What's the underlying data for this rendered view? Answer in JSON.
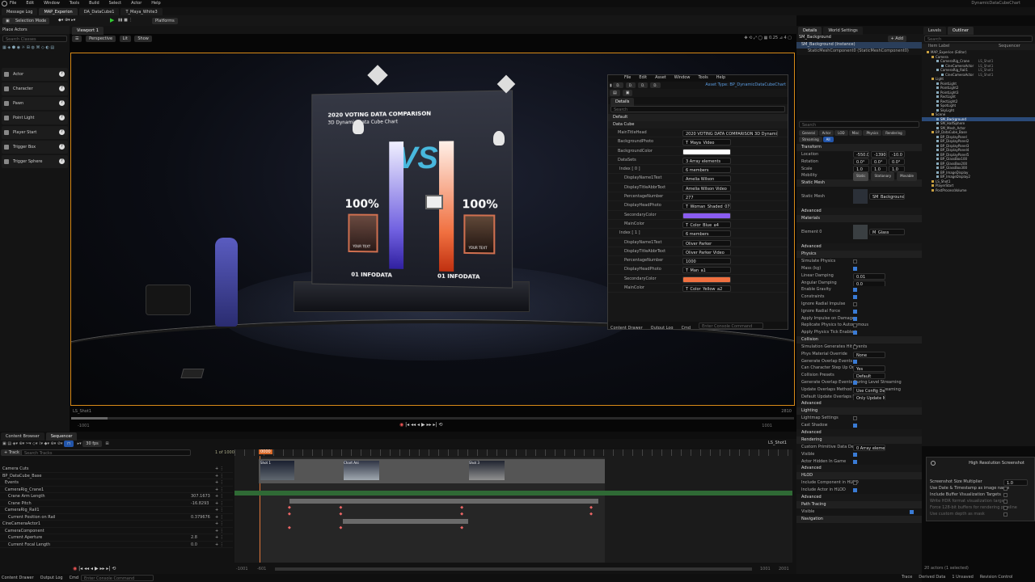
{
  "menubar": {
    "items": [
      "File",
      "Edit",
      "Window",
      "Tools",
      "Build",
      "Select",
      "Actor",
      "Help"
    ],
    "project": "DynamicDataCubeChart"
  },
  "tabs": [
    "Message Log",
    "MAP_Experion",
    "DA_DataCube1",
    "T_Maya_White3"
  ],
  "toolbar": {
    "mode": "Selection Mode",
    "platforms": "Platforms"
  },
  "place_actors": {
    "title": "Place Actors",
    "search": "Search Classes",
    "items": [
      "Actor",
      "Character",
      "Pawn",
      "Point Light",
      "Player Start",
      "Trigger Box",
      "Trigger Sphere"
    ]
  },
  "viewport": {
    "tab": "Viewport 1",
    "perspective": "Perspective",
    "lit": "Lit",
    "show": "Show",
    "camera": "LS_Shot1",
    "timecode_left": "-1001",
    "timecode_right": "2810",
    "num_right": "0.25",
    "num_right2": "4",
    "frames_left": "-1001",
    "frames_right": "1001"
  },
  "scene": {
    "title1": "2020 VOTING DATA COMPARISON",
    "title2": "3D Dynamic Data Cube Chart",
    "vs": "VS",
    "left_pct": "100%",
    "right_pct": "100%",
    "left_label": "01 INFODATA",
    "right_label": "01 INFODATA",
    "your_text": "YOUR TEXT"
  },
  "floating": {
    "menu": [
      "File",
      "Edit",
      "Asset",
      "Window",
      "Tools",
      "Help"
    ],
    "tab": "Details",
    "search": "Search",
    "asset_type": "Asset Type: BP_DynamicDataCubeChart",
    "default": "Default",
    "data_cube": "Data Cube",
    "rows": [
      {
        "label": "MainTitleHead",
        "value": "2020 VOTING DATA COMPARISON 3D Dynamic Data Cube Chart"
      },
      {
        "label": "BackgroundPhoto",
        "value": "T_Maya_Video"
      },
      {
        "label": "BackgroundColor",
        "value": ""
      },
      {
        "label": "DataSets",
        "value": "3 Array elements"
      },
      {
        "label": "Index [ 0 ]",
        "value": "6 members"
      },
      {
        "label": "DisplayName1Text",
        "value": "Amelia Wilson"
      },
      {
        "label": "DisplayTitleAbbrText",
        "value": "Amelia Wilson Video"
      },
      {
        "label": "PercentageNumber",
        "value": "277"
      },
      {
        "label": "DisplayHeadPhoto",
        "value": "T_Woman_Shaded_07"
      },
      {
        "label": "SecondaryColor",
        "value": ""
      },
      {
        "label": "MainColor",
        "value": "T_Color_Blue_a4"
      },
      {
        "label": "Index [ 1 ]",
        "value": "6 members"
      },
      {
        "label": "DisplayName1Text",
        "value": "Oliver Parker"
      },
      {
        "label": "DisplayTitleAbbrText",
        "value": "Oliver Parker Video"
      },
      {
        "label": "PercentageNumber",
        "value": "1000"
      },
      {
        "label": "DisplayHeadPhoto",
        "value": "T_Man_a1"
      },
      {
        "label": "SecondaryColor",
        "value": ""
      },
      {
        "label": "MainColor",
        "value": "T_Color_Yellow_a2"
      }
    ],
    "footer": [
      "Content Drawer",
      "Output Log",
      "Cmd"
    ],
    "console": "Enter Console Command"
  },
  "details": {
    "tab": "Details",
    "tab2": "World Settings",
    "actor": "SM_Background",
    "add": "+ Add",
    "instance": "SM_Background (Instance)",
    "component": "StaticMeshComponent0 (StaticMeshComponent0)",
    "search": "Search",
    "filters": [
      "General",
      "Actor",
      "LOD",
      "Misc",
      "Physics",
      "Rendering",
      "Streaming",
      "All"
    ],
    "transform": "Transform",
    "location": "Location",
    "rotation": "Rotation",
    "scale": "Scale",
    "loc_vals": [
      "-550.0",
      "-1390.80",
      "-10.0"
    ],
    "rot_vals": [
      "0.0°",
      "0.0°",
      "0.0°"
    ],
    "scale_vals": [
      "1.0",
      "1.0",
      "1.0"
    ],
    "mobility": "Mobility",
    "mob_opts": [
      "Static",
      "Stationary",
      "Movable"
    ],
    "static_mesh_sec": "Static Mesh",
    "static_mesh": "Static Mesh",
    "mesh_val": "SM_Background",
    "materials": "Materials",
    "element0": "Element 0",
    "mat_val": "M_Glass",
    "physics": "Physics",
    "phys_rows": [
      "Simulate Physics",
      "Mass (kg)",
      "Linear Damping",
      "Angular Damping",
      "Enable Gravity",
      "Constraints",
      "Ignore Radial Impulse",
      "Ignore Radial Force",
      "Apply Impulse on Damage",
      "Replicate Physics to Autonomous",
      "Apply Physics Tick Enabled"
    ],
    "phys_vals": [
      "",
      "",
      "0.01",
      "0.0",
      "",
      "",
      "",
      "",
      "",
      "",
      ""
    ],
    "collision": "Collision",
    "coll_rows": [
      "Simulation Generates Hit Events",
      "Phys Material Override",
      "Generate Overlap Events",
      "Can Character Step Up On",
      "Collision Presets",
      "Generate Overlap Events During Level Streaming",
      "Update Overlaps Method During Level Streaming",
      "Default Update Overlaps Method"
    ],
    "coll_vals": [
      "",
      "None",
      "",
      "Yes",
      "Default",
      "",
      "Use Config Default",
      "Only Update Movable"
    ],
    "lighting": "Lighting",
    "light_rows": [
      "Lightmap Settings",
      "Cast Shadow"
    ],
    "rendering": "Rendering",
    "rend_rows": [
      "Custom Primitive Data Defaults",
      "Visible",
      "Actor Hidden In Game"
    ],
    "rend_vals": [
      "0 Array elements",
      "",
      ""
    ],
    "hlod": "HLOD",
    "hlod_rows": [
      "Include Component in HLOD",
      "Include Actor in HLOD"
    ],
    "path_tracing": "Path Tracing",
    "visible": "Visible",
    "navigation": "Navigation",
    "advanced": "Advanced"
  },
  "outliner": {
    "tab": "Levels",
    "tab2": "Outliner",
    "search": "Search",
    "col1": "Item Label",
    "col2": "Sequencer",
    "items": [
      {
        "t": "MAP_Experion (Editor)",
        "d": 0
      },
      {
        "t": "Camera",
        "d": 1
      },
      {
        "t": "CameraRig_Crane",
        "d": 2,
        "x": "LS_Shot1"
      },
      {
        "t": "CineCameraActor",
        "d": 3,
        "x": "LS_Shot1"
      },
      {
        "t": "CameraRig_Rail1",
        "d": 2,
        "x": "LS_Shot1"
      },
      {
        "t": "CineCameraActor",
        "d": 3,
        "x": "LS_Shot1"
      },
      {
        "t": "Light",
        "d": 1
      },
      {
        "t": "PointLight",
        "d": 2
      },
      {
        "t": "PointLight2",
        "d": 2
      },
      {
        "t": "PointLight3",
        "d": 2
      },
      {
        "t": "RectLight",
        "d": 2
      },
      {
        "t": "RectLight2",
        "d": 2
      },
      {
        "t": "SpotLight",
        "d": 2
      },
      {
        "t": "SkyLight",
        "d": 2
      },
      {
        "t": "Scene",
        "d": 1
      },
      {
        "t": "SM_Background",
        "d": 2,
        "sel": true
      },
      {
        "t": "SM_HalfSphere",
        "d": 2
      },
      {
        "t": "SM_Mesh_Actor",
        "d": 2
      },
      {
        "t": "BP_DataCube_Base",
        "d": 1
      },
      {
        "t": "BP_DisplayPanel",
        "d": 2
      },
      {
        "t": "BP_DisplayPanel2",
        "d": 2
      },
      {
        "t": "BP_DisplayPanel3",
        "d": 2
      },
      {
        "t": "BP_DisplayPanel4",
        "d": 2
      },
      {
        "t": "BP_DisplayPanel5",
        "d": 2
      },
      {
        "t": "BP_GlassBox100",
        "d": 2
      },
      {
        "t": "BP_GlassBox200",
        "d": 2
      },
      {
        "t": "BP_GlassBox300",
        "d": 2
      },
      {
        "t": "BP_ImageDisplay",
        "d": 2
      },
      {
        "t": "BP_ImageDisplay2",
        "d": 2
      },
      {
        "t": "LS_Shot1",
        "d": 1
      },
      {
        "t": "PlayerStart",
        "d": 1
      },
      {
        "t": "PostProcessVolume",
        "d": 1
      }
    ],
    "footer": "20 actors (1 selected)"
  },
  "hrs": {
    "title": "High Resolution Screenshot",
    "rows": [
      "Screenshot Size Multiplier",
      "Use Date & Timestamp as image name",
      "Include Buffer Visualization Targets",
      "Write HDR format visualization targets",
      "Force 128-bit buffers for rendering pipeline",
      "Use custom depth as mask"
    ],
    "mult": "1.0"
  },
  "sequencer": {
    "tab1": "Content Browser",
    "tab2": "Sequencer",
    "fps": "30 fps",
    "shot": "LS_Shot1",
    "search": "Search Tracks",
    "counter": "1 of 1000",
    "track_btn": "+ Track",
    "frame": "0000",
    "tracks": [
      "Camera Cuts",
      "BP_DataCube_Base",
      "Events",
      "CameraRig_Crane1",
      "Crane Arm Length",
      "Crane Pitch",
      "CameraRig_Rail1",
      "Current Position on Rail",
      "CineCameraActor1",
      "CameraComponent",
      "Current Aperture",
      "Current Focal Length"
    ],
    "track_vals": [
      "",
      "",
      "",
      "",
      "307.1673",
      "-16.8293",
      "",
      "0.379676",
      "",
      "",
      "2.8",
      "0.0"
    ],
    "shots": [
      "Shot 1",
      "Chart Ani",
      "Shot 3"
    ],
    "end_left": "-1001",
    "end_left2": "-601",
    "end_right": "1001",
    "end_right2": "2001"
  },
  "statusbar": {
    "items": [
      "Content Drawer",
      "Output Log",
      "Cmd"
    ],
    "console": "Enter Console Command",
    "right": [
      "Trace",
      "Derived Data",
      "1 Unsaved",
      "Revision Control"
    ]
  }
}
